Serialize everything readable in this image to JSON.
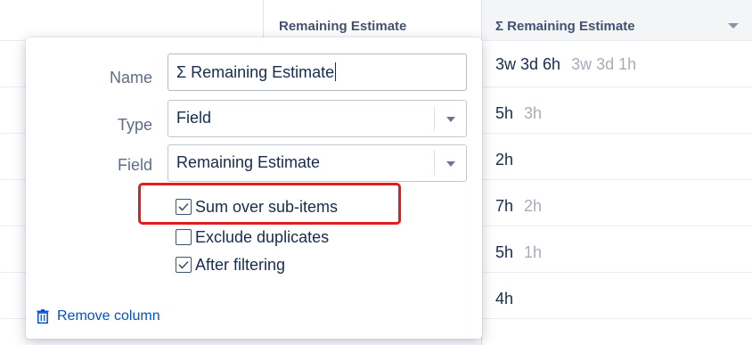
{
  "table": {
    "header_remaining": "Remaining Estimate",
    "header_sum": "Σ Remaining Estimate",
    "rows": [
      {
        "primary": "3w 3d 6h",
        "secondary": "3w 3d 1h"
      },
      {
        "primary": "5h",
        "secondary": "3h"
      },
      {
        "primary": "2h",
        "secondary": ""
      },
      {
        "primary": "7h",
        "secondary": "2h"
      },
      {
        "primary": "5h",
        "secondary": "1h"
      },
      {
        "primary": "4h",
        "secondary": ""
      }
    ]
  },
  "popup": {
    "name_label": "Name",
    "name_value": "Σ Remaining Estimate",
    "type_label": "Type",
    "type_value": "Field",
    "field_label": "Field",
    "field_value": "Remaining Estimate",
    "options": [
      {
        "label": "Sum over sub-items",
        "checked": true
      },
      {
        "label": "Exclude duplicates",
        "checked": false
      },
      {
        "label": "After filtering",
        "checked": true
      }
    ],
    "remove_label": "Remove column"
  },
  "colors": {
    "highlight": "#e11d1d",
    "link": "#0052cc"
  },
  "icons": [
    "chevron-down-icon",
    "trash-icon",
    "checkmark-icon"
  ]
}
